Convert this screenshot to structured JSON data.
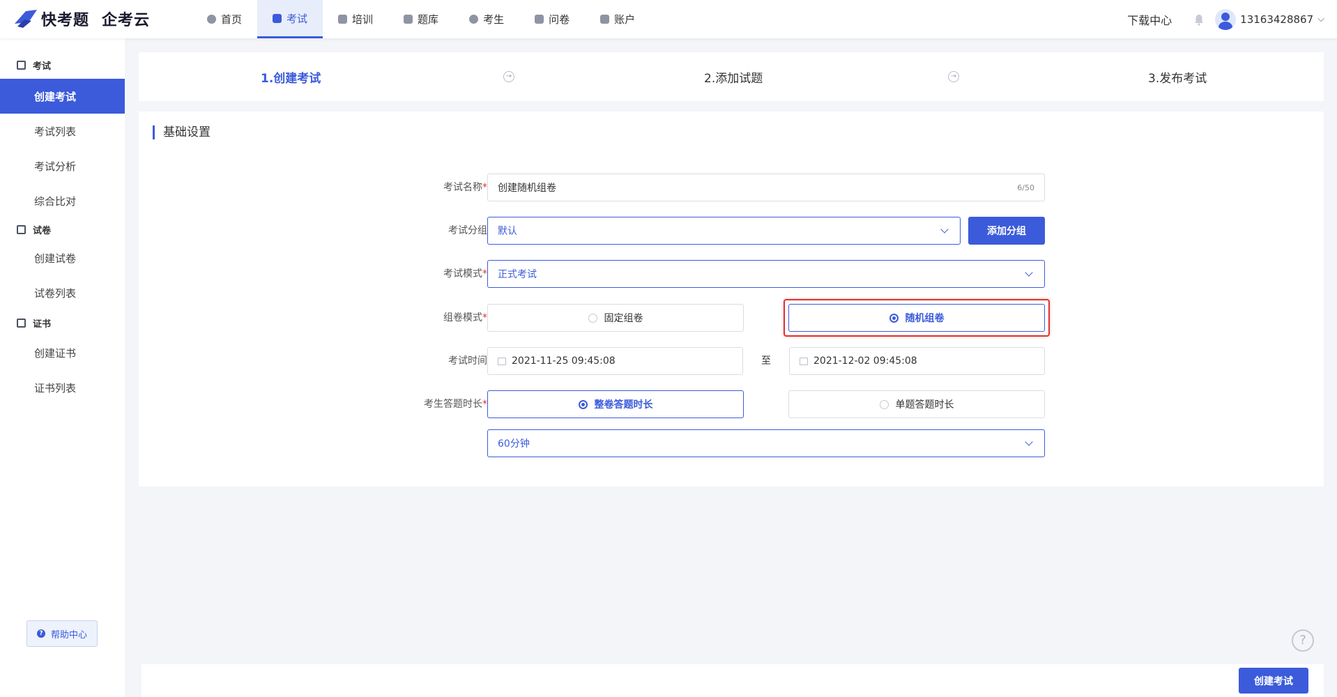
{
  "brand": {
    "name": "快考题",
    "sub": "企考云"
  },
  "nav": [
    {
      "label": "首页",
      "icon": "home-icon"
    },
    {
      "label": "考试",
      "icon": "exam-icon",
      "active": true
    },
    {
      "label": "培训",
      "icon": "training-icon"
    },
    {
      "label": "题库",
      "icon": "question-bank-icon"
    },
    {
      "label": "考生",
      "icon": "candidate-icon"
    },
    {
      "label": "问卷",
      "icon": "survey-icon"
    },
    {
      "label": "账户",
      "icon": "account-icon"
    }
  ],
  "header": {
    "download": "下载中心",
    "user": "13163428867"
  },
  "sidebar": {
    "groups": [
      {
        "title": "考试",
        "items": [
          "创建考试",
          "考试列表",
          "考试分析",
          "综合比对"
        ]
      },
      {
        "title": "试卷",
        "items": [
          "创建试卷",
          "试卷列表"
        ]
      },
      {
        "title": "证书",
        "items": [
          "创建证书",
          "证书列表"
        ]
      }
    ],
    "help": "帮助中心"
  },
  "steps": [
    "1.创建考试",
    "2.添加试题",
    "3.发布考试"
  ],
  "form": {
    "section_title": "基础设置",
    "name": {
      "label": "考试名称",
      "value": "创建随机组卷",
      "count": "6/50"
    },
    "group": {
      "label": "考试分组",
      "value": "默认",
      "add": "添加分组"
    },
    "mode": {
      "label": "考试模式",
      "value": "正式考试"
    },
    "paper": {
      "label": "组卷模式",
      "opt1": "固定组卷",
      "opt2": "随机组卷"
    },
    "time": {
      "label": "考试时间",
      "start": "2021-11-25 09:45:08",
      "to": "至",
      "end": "2021-12-02 09:45:08"
    },
    "duration": {
      "label": "考生答题时长",
      "opt1": "整卷答题时长",
      "opt2": "单题答题时长",
      "value": "60分钟"
    }
  },
  "footer": {
    "create": "创建考试"
  },
  "colors": {
    "primary": "#3b5bdb",
    "highlight": "#e03131"
  }
}
